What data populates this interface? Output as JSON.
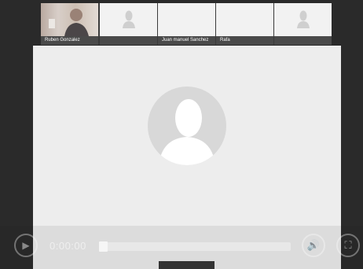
{
  "participants": [
    {
      "name": "Ruben Gonzalez",
      "has_video": true
    },
    {
      "name": "",
      "has_video": false
    },
    {
      "name": "Juan manuel Sanchez",
      "has_video": false
    },
    {
      "name": "Rafa",
      "has_video": false
    },
    {
      "name": "",
      "has_video": false
    }
  ],
  "player": {
    "time": "0:00:00",
    "progress": 0
  },
  "icons": {
    "play": "play-icon",
    "volume": "volume-icon",
    "fullscreen": "fullscreen-icon",
    "avatar": "person-silhouette-icon"
  },
  "colors": {
    "background": "#2a2a2a",
    "stage": "#ededed",
    "name_bar": "#4a4a4a"
  }
}
